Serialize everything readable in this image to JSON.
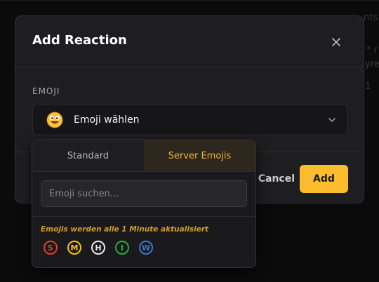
{
  "background": {
    "fragment_right_1": "nts",
    "fragment_right_2": "* r",
    "fragment_right_3": "yre",
    "fragment_right_4": "1"
  },
  "modal": {
    "title": "Add Reaction",
    "field_label": "EMOJI",
    "select_text": "Emoji wählen",
    "cancel_label": "Cancel",
    "add_label": "Add"
  },
  "dropdown": {
    "tabs": [
      {
        "label": "Standard",
        "active": false
      },
      {
        "label": "Server Emojis",
        "active": true
      }
    ],
    "search_placeholder": "Emoji suchen...",
    "update_note": "Emojis werden alle 1 Minute aktualisiert",
    "emojis": [
      {
        "letter": "S",
        "color": "#e53935"
      },
      {
        "letter": "M",
        "color": "#f2c318"
      },
      {
        "letter": "H",
        "color": "#e8e8e8"
      },
      {
        "letter": "I",
        "color": "#27a844"
      },
      {
        "letter": "W",
        "color": "#3a78c9"
      }
    ]
  },
  "colors": {
    "accent": "#fbbd2c",
    "active_tab_text": "#f0b43a",
    "note_text": "#d49a2a"
  }
}
